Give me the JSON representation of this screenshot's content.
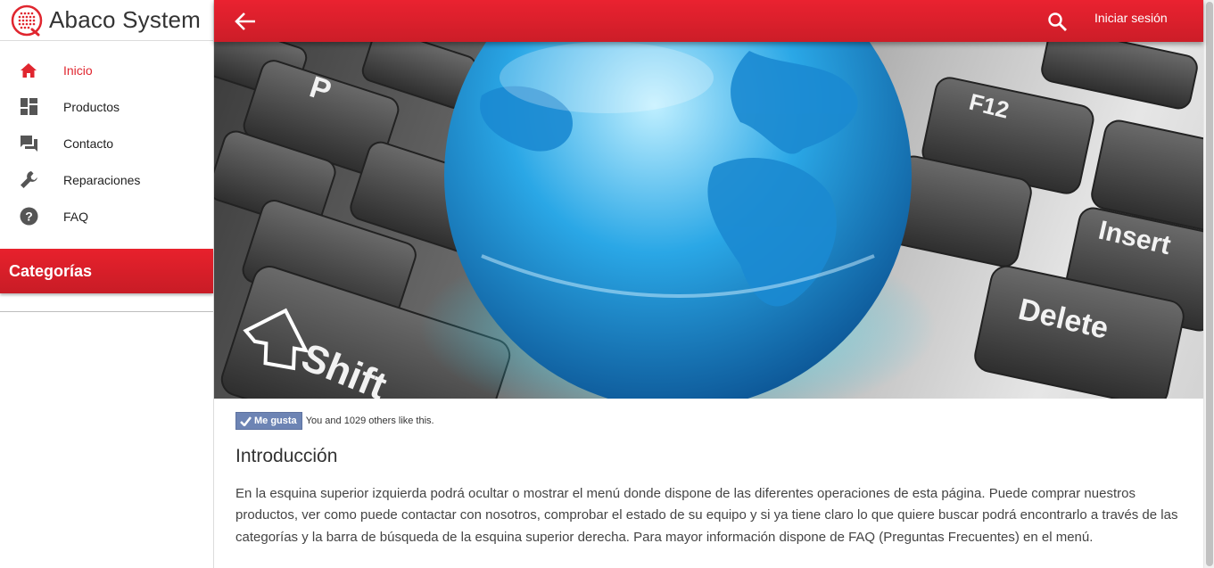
{
  "brand": {
    "name": "Abaco System",
    "accent": "#e0262f"
  },
  "sidebar": {
    "items": [
      {
        "label": "Inicio",
        "icon": "home-icon",
        "active": true
      },
      {
        "label": "Productos",
        "icon": "dashboard-icon",
        "active": false
      },
      {
        "label": "Contacto",
        "icon": "chat-icon",
        "active": false
      },
      {
        "label": "Reparaciones",
        "icon": "wrench-icon",
        "active": false
      },
      {
        "label": "FAQ",
        "icon": "help-icon",
        "active": false
      }
    ],
    "categories_title": "Categorías"
  },
  "toolbar": {
    "back_icon": "arrow-back-icon",
    "search_icon": "search-icon",
    "login_label": "Iniciar sesión"
  },
  "hero": {
    "keys": [
      "P",
      "F12",
      "Shift",
      "Insert",
      "Delete"
    ]
  },
  "like": {
    "button_label": "Me gusta",
    "text": "You and 1029 others like this."
  },
  "intro": {
    "title": "Introducción",
    "text": "En la esquina superior izquierda podrá ocultar o mostrar el menú donde dispone de las diferentes operaciones de esta página. Puede comprar nuestros productos, ver como puede contactar con nosotros, comprobar el estado de su equipo y si ya tiene claro lo que quiere buscar podrá encontrarlo a través de las categorías y la barra de búsqueda de la esquina superior derecha. Para mayor información dispone de FAQ (Preguntas Frecuentes) en el menú."
  }
}
